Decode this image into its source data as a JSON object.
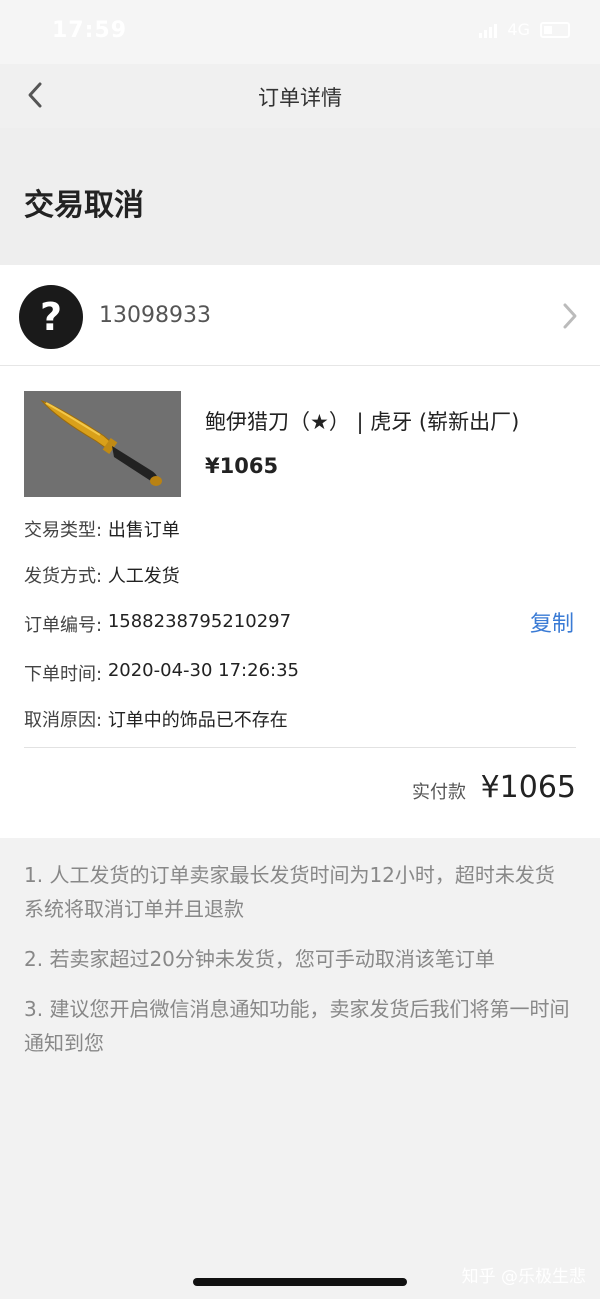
{
  "status_bar": {
    "time": "17:59",
    "network": "4G"
  },
  "nav": {
    "title": "订单详情"
  },
  "order_status": {
    "title": "交易取消"
  },
  "seller": {
    "avatar_glyph": "?",
    "id": "13098933"
  },
  "item": {
    "name": "鲍伊猎刀（★） | 虎牙 (崭新出厂)",
    "price": "¥1065"
  },
  "details": [
    {
      "label": "交易类型:",
      "value": "出售订单"
    },
    {
      "label": "发货方式:",
      "value": "人工发货"
    },
    {
      "label": "订单编号:",
      "value": "1588238795210297"
    },
    {
      "label": "下单时间:",
      "value": "2020-04-30 17:26:35"
    },
    {
      "label": "取消原因:",
      "value": "订单中的饰品已不存在"
    }
  ],
  "copy_label": "复制",
  "payment": {
    "label": "实付款",
    "amount": "¥1065"
  },
  "notes": [
    "1. 人工发货的订单卖家最长发货时间为12小时，超时未发货系统将取消订单并且退款",
    "2. 若卖家超过20分钟未发货，您可手动取消该笔订单",
    "3. 建议您开启微信消息通知功能，卖家发货后我们将第一时间通知到您"
  ],
  "watermark": "知乎 @乐极生悲",
  "colors": {
    "accent": "#3a7bd5",
    "avatar_bg": "#1a1a1a",
    "knife_blade": "#d9a01a"
  }
}
